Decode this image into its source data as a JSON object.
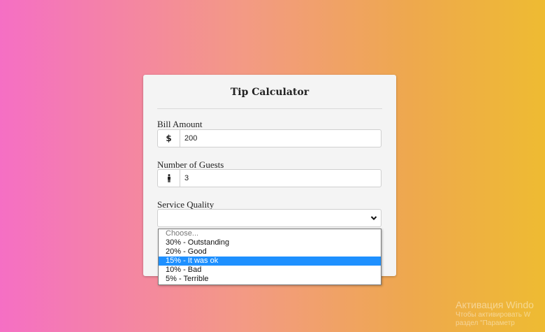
{
  "card": {
    "title": "Tip Calculator",
    "bill": {
      "label": "Bill Amount",
      "prefix": "$",
      "value": "200"
    },
    "guests": {
      "label": "Number of Guests",
      "prefix_icon": "person-icon",
      "value": "3"
    },
    "service": {
      "label": "Service Quality",
      "selected_value": "",
      "options": [
        "Choose...",
        "30% - Outstanding",
        "20% - Good",
        "15% - It was ok",
        "10% - Bad",
        "5% - Terrible"
      ],
      "highlighted_index": 3
    }
  },
  "watermark": {
    "title": "Активация Windo",
    "line1": "Чтобы активировать W",
    "line2": "раздел \"Параметр"
  },
  "colors": {
    "gradient_left": "#f56fc4",
    "gradient_mid": "#f39a84",
    "gradient_right": "#eebb32",
    "highlight": "#1e90ff",
    "card_bg": "#f4f4f4"
  }
}
